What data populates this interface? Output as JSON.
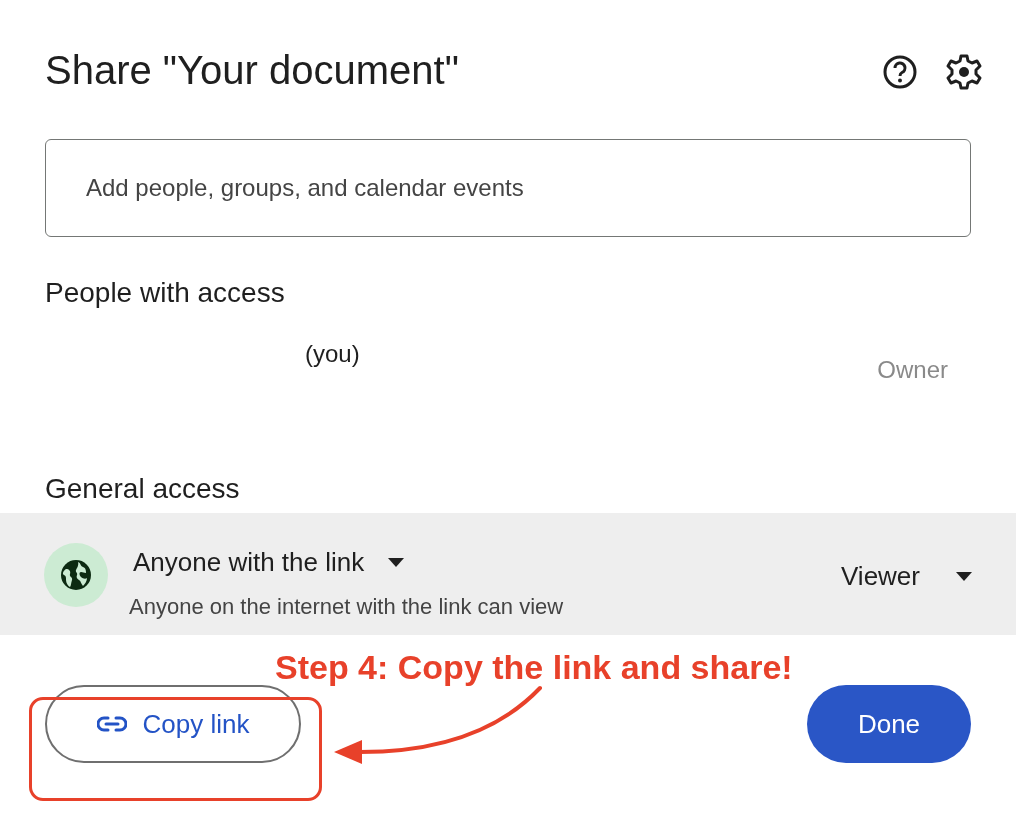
{
  "dialog": {
    "title": "Share \"Your document\""
  },
  "search": {
    "placeholder": "Add people, groups, and calendar events"
  },
  "people": {
    "heading": "People with access",
    "items": [
      {
        "name": "(you)",
        "role": "Owner"
      }
    ]
  },
  "general_access": {
    "heading": "General access",
    "scope": "Anyone with the link",
    "description": "Anyone on the internet with the link can view",
    "role": "Viewer"
  },
  "annotation": {
    "text": "Step 4: Copy the link and share!"
  },
  "buttons": [
    {
      "label": "Copy link",
      "kind": "outline"
    },
    {
      "label": "Done",
      "kind": "primary"
    }
  ]
}
